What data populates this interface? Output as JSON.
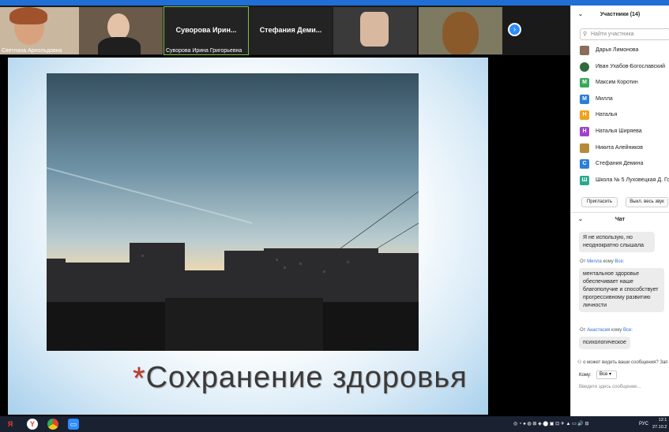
{
  "video_strip": {
    "tiles": [
      {
        "name": "Светлана Арнольдовна"
      },
      {
        "name": ""
      },
      {
        "name": "Суворова Ирина Григорьевна",
        "big_name": "Суворова  Ирин..."
      },
      {
        "name": "",
        "big_name": "Стефания  Деми..."
      },
      {
        "name": ""
      },
      {
        "name": ""
      }
    ],
    "next_icon": "chevron-right-icon"
  },
  "slide": {
    "title": "Сохранение здоровья",
    "bullet": "*"
  },
  "participants": {
    "header": "Участники (14)",
    "search_placeholder": "Найти участника",
    "items": [
      {
        "initial": "",
        "name": "Дарья Лимонова",
        "color": "#8a6d5a"
      },
      {
        "initial": "",
        "name": "Иван Ухабов-Богославский",
        "color": "#2f6b3a"
      },
      {
        "initial": "М",
        "name": "Максим Коротин",
        "color": "#38a85a"
      },
      {
        "initial": "М",
        "name": "Милла",
        "color": "#2b7fd6"
      },
      {
        "initial": "Н",
        "name": "Наталья",
        "color": "#f0a21b"
      },
      {
        "initial": "Н",
        "name": "Наталья Ширяева",
        "color": "#a044c8"
      },
      {
        "initial": "",
        "name": "Никита Алейников",
        "color": "#b58a3a"
      },
      {
        "initial": "С",
        "name": "Стефания Демина",
        "color": "#2b7fd6"
      },
      {
        "initial": "Ш",
        "name": "Школа № 5 Луховецкая Д. Го...",
        "color": "#2aa88a"
      }
    ],
    "invite_label": "Пригласить",
    "mute_all_label": "Выкл. весь звук"
  },
  "chat": {
    "header": "Чат",
    "messages": [
      {
        "from_prefix": "",
        "from_name": "",
        "to": "",
        "text": "Я не использую, но неоднократно слышала"
      },
      {
        "from_prefix": "От",
        "from_name": "Милла",
        "to_word": "кому",
        "to": "Все:",
        "text": "ментальное здоровье обеспечивает наше благополучие и способствует прогрессивному развитию личности"
      },
      {
        "from_prefix": "От",
        "from_name": "Анастасия",
        "to_word": "кому",
        "to": "Все:",
        "text": "психологическое"
      }
    ],
    "privacy_note": "о может видеть ваши сообщения? Зап",
    "to_label": "Кому:",
    "to_value": "Все",
    "input_placeholder": "Введите здесь сообщение..."
  },
  "taskbar": {
    "language": "РУС",
    "time": "12:1",
    "date": "27.10.2"
  }
}
